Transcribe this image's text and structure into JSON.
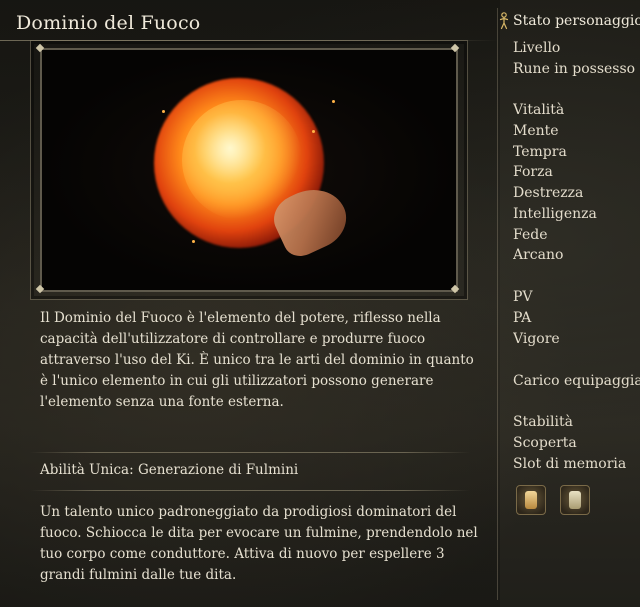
{
  "item": {
    "title": "Dominio del Fuoco",
    "description": "Il Dominio del Fuoco è l'elemento del potere, riflesso nella capacità dell'utilizzatore di controllare e produrre fuoco attraverso l'uso del Ki. È unico tra le arti del dominio in quanto è l'unico elemento in cui gli utilizzatori possono generare l'elemento senza una fonte esterna.",
    "ability_title": "Abilità Unica: Generazione di Fulmini",
    "ability_description": "Un talento unico padroneggiato da prodigiosi dominatori del fuoco. Schiocca le dita per evocare un fulmine, prendendolo nel tuo corpo come conduttore. Attiva di nuovo per espellere 3 grandi fulmini dalle tue dita."
  },
  "stats_panel": {
    "header": "Stato personaggio",
    "header_icon": "person-icon",
    "group1": [
      "Livello",
      "Rune in possesso"
    ],
    "group2": [
      "Vitalità",
      "Mente",
      "Tempra",
      "Forza",
      "Destrezza",
      "Intelligenza",
      "Fede",
      "Arcano"
    ],
    "group3": [
      "PV",
      "PA",
      "Vigore"
    ],
    "group4": [
      "Carico equipaggiam"
    ],
    "group5": [
      "Stabilità",
      "Scoperta",
      "Slot di memoria"
    ],
    "slot_icons": [
      "memory-slot-icon",
      "memory-slot-icon"
    ]
  }
}
